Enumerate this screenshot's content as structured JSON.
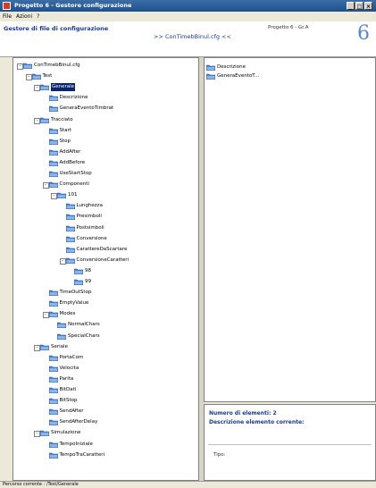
{
  "window": {
    "title": "Progetto 6 - Gestore configurazione",
    "buttons": [
      "_",
      "□",
      "×"
    ]
  },
  "menu": [
    "File",
    "Azioni",
    "?"
  ],
  "header": {
    "title": "Gestore di file di configurazione",
    "project": "Progetto 6 - Gr.A",
    "config_file": ">> ConTimebBinul.cfg <<",
    "logo": "6"
  },
  "tree": [
    {
      "label": "ConTimebBinul.cfg",
      "depth": 0,
      "exp": "-"
    },
    {
      "label": "Test",
      "depth": 1,
      "exp": "-"
    },
    {
      "label": "Generale",
      "depth": 2,
      "exp": "-",
      "selected": true
    },
    {
      "label": "Descrizione",
      "depth": 3
    },
    {
      "label": "GeneraEventoTimbrat",
      "depth": 3
    },
    {
      "label": "Tracciato",
      "depth": 2,
      "exp": "-"
    },
    {
      "label": "Start",
      "depth": 3
    },
    {
      "label": "Stop",
      "depth": 3
    },
    {
      "label": "AddAfter",
      "depth": 3
    },
    {
      "label": "AddBefore",
      "depth": 3
    },
    {
      "label": "UseStartStop",
      "depth": 3
    },
    {
      "label": "Componenti",
      "depth": 3,
      "exp": "-"
    },
    {
      "label": "101",
      "depth": 4,
      "exp": "-"
    },
    {
      "label": "Lunghezza",
      "depth": 5
    },
    {
      "label": "Presimboli",
      "depth": 5
    },
    {
      "label": "Postsimboli",
      "depth": 5
    },
    {
      "label": "Conversione",
      "depth": 5
    },
    {
      "label": "CarattereDaScartare",
      "depth": 5
    },
    {
      "label": "ConversioneCaratteri",
      "depth": 5,
      "exp": "-"
    },
    {
      "label": "98",
      "depth": 6
    },
    {
      "label": "99",
      "depth": 6
    },
    {
      "label": "TimeOutStop",
      "depth": 3
    },
    {
      "label": "EmptyValue",
      "depth": 3
    },
    {
      "label": "Modes",
      "depth": 3,
      "exp": "-"
    },
    {
      "label": "NormalChars",
      "depth": 4
    },
    {
      "label": "SpecialChars",
      "depth": 4
    },
    {
      "label": "Seriale",
      "depth": 2,
      "exp": "-"
    },
    {
      "label": "PortaCom",
      "depth": 3
    },
    {
      "label": "Velocita",
      "depth": 3
    },
    {
      "label": "Parita",
      "depth": 3
    },
    {
      "label": "BitDati",
      "depth": 3
    },
    {
      "label": "BitStop",
      "depth": 3
    },
    {
      "label": "SendAfter",
      "depth": 3
    },
    {
      "label": "SendAfterDelay",
      "depth": 3
    },
    {
      "label": "Simulazione",
      "depth": 2,
      "exp": "-"
    },
    {
      "label": "TempoIniziale",
      "depth": 3
    },
    {
      "label": "TempoTraCaratteri",
      "depth": 3
    }
  ],
  "list": [
    {
      "label": "Descrizione"
    },
    {
      "label": "GeneraEventoT..."
    }
  ],
  "info": {
    "count_label": "Numero di elementi:",
    "count_value": "2",
    "desc_label": "Descrizione elemento corrente:",
    "type_label": "Tipo:"
  },
  "status": "Percorso corrente : /Test/Generale",
  "colors": {
    "selection": "#0a246a",
    "folder": "#4f86d9",
    "header_text": "#1a3a8c"
  }
}
